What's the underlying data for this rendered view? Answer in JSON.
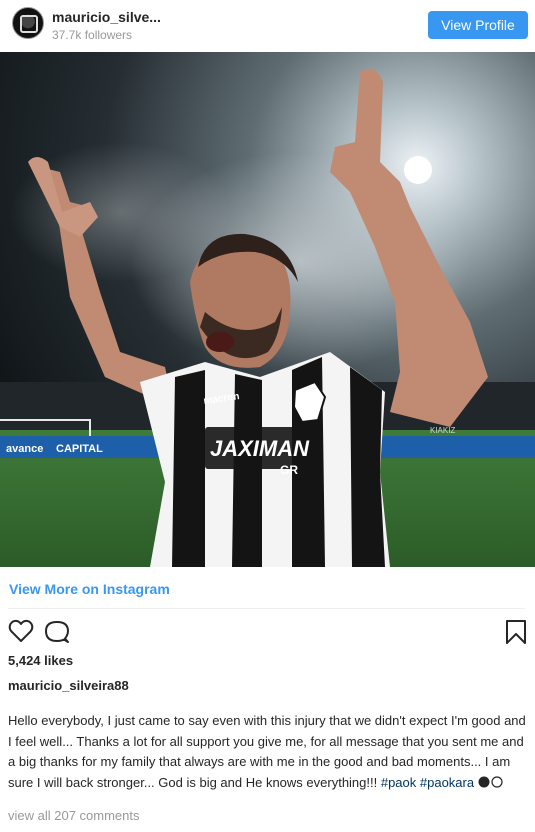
{
  "header": {
    "username": "mauricio_silve...",
    "followers": "37.7k followers",
    "view_profile_label": "View Profile"
  },
  "photo": {
    "jersey_sponsor": "JAXIMAN",
    "jersey_sponsor_sub": "GR",
    "kit_brand": "macron",
    "ad_board_1": "avance",
    "ad_board_2": "CAPITAL",
    "ad_board_3": "KIAKIZ"
  },
  "view_more_label": "View More on Instagram",
  "actions": {
    "like_icon": "heart-icon",
    "comment_icon": "comment-icon",
    "save_icon": "bookmark-icon"
  },
  "likes": "5,424 likes",
  "author": "mauricio_silveira88",
  "caption": {
    "text": "Hello everybody, I just came to say even with this injury that we didn't expect I'm good and I feel well... Thanks a lot for all support you give me, for all message that you sent me and a big thanks for my family that always are with me in the good and bad moments... I am sure I will back stronger... God is big and He knows everything!!! ",
    "tag_1": "#paok",
    "tag_2": "#paokara"
  },
  "view_comments": "view all 207 comments",
  "colors": {
    "accent": "#3897f0",
    "text": "#262626",
    "muted": "#999999",
    "hashtag": "#003569"
  }
}
